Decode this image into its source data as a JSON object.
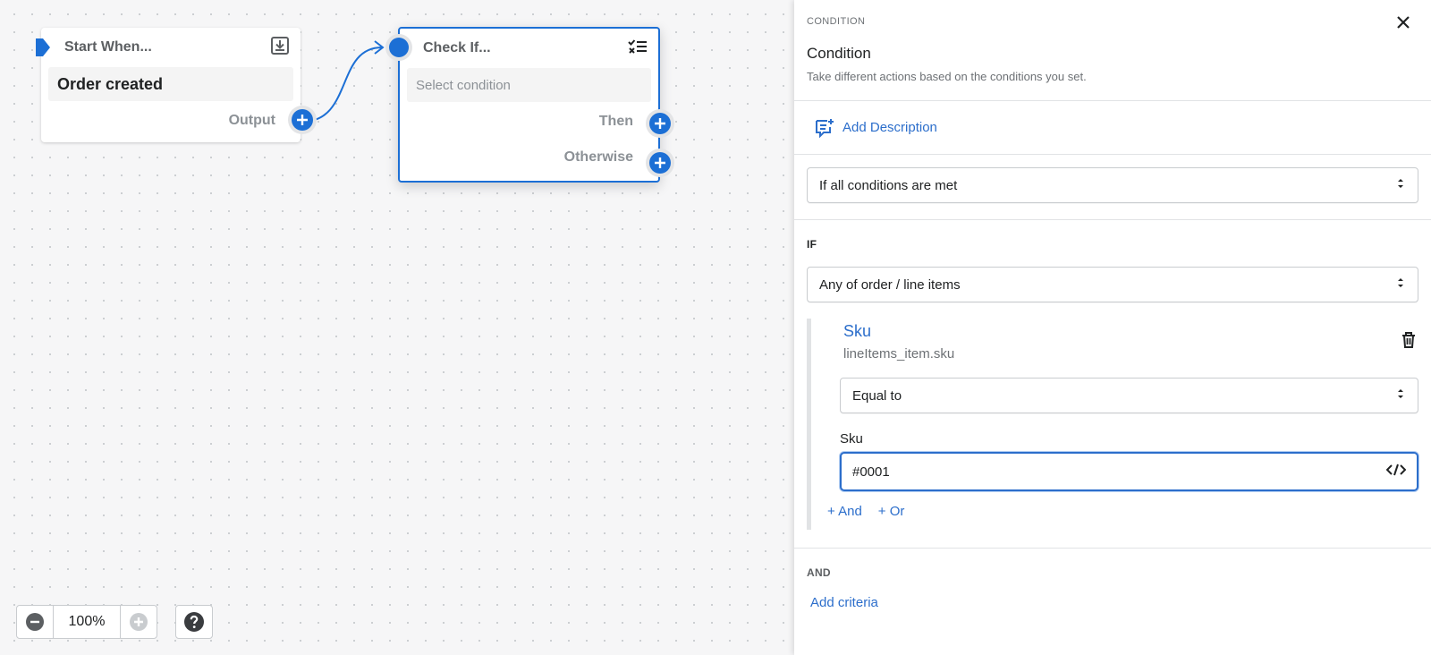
{
  "canvas": {
    "start_node": {
      "title": "Start When...",
      "trigger": "Order created",
      "output_label": "Output"
    },
    "check_node": {
      "title": "Check If...",
      "placeholder": "Select condition",
      "then_label": "Then",
      "otherwise_label": "Otherwise"
    },
    "zoom": {
      "value": "100%"
    }
  },
  "panel": {
    "eyebrow": "CONDITION",
    "title": "Condition",
    "subtitle": "Take different actions based on the conditions you set.",
    "add_description": "Add Description",
    "match_select": "If all conditions are met",
    "if_label": "IF",
    "scope_select": "Any of order / line items",
    "condition": {
      "field_title": "Sku",
      "field_path": "lineItems_item.sku",
      "operator": "Equal to",
      "value_label": "Sku",
      "value": "#0001",
      "and_link": "+ And",
      "or_link": "+ Or"
    },
    "and_label": "AND",
    "add_criteria": "Add criteria"
  },
  "colors": {
    "accent": "#1c6fd5",
    "link": "#2c6ecb"
  },
  "icons": [
    "play-marker-icon",
    "download-icon",
    "checklist-icon",
    "plus-icon",
    "close-icon",
    "comment-add-icon",
    "select-caret-icon",
    "trash-icon",
    "code-icon",
    "minus-icon",
    "help-icon"
  ]
}
